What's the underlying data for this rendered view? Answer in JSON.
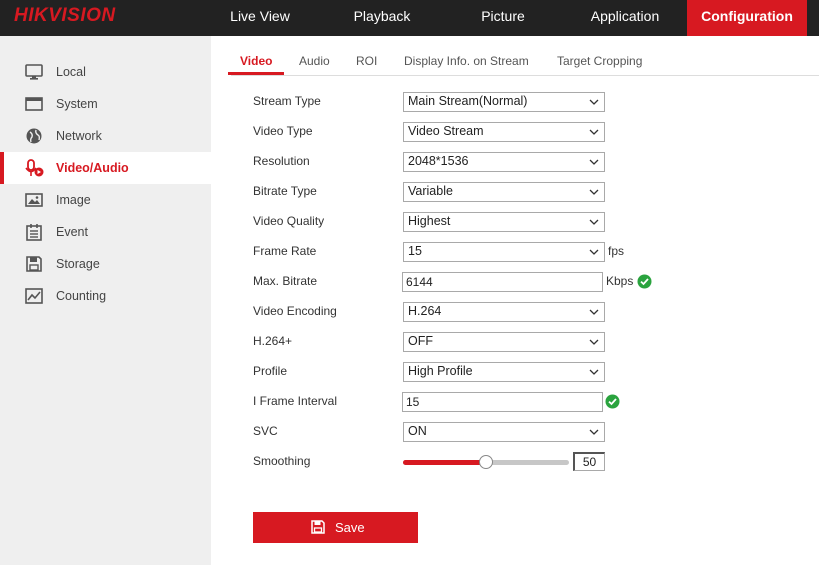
{
  "brand": {
    "logo": "HIKVISION",
    "accent": "#d71921"
  },
  "nav": {
    "items": [
      {
        "label": "Live View"
      },
      {
        "label": "Playback"
      },
      {
        "label": "Picture"
      },
      {
        "label": "Application"
      },
      {
        "label": "Configuration",
        "active": true
      }
    ]
  },
  "sidebar": {
    "items": [
      {
        "label": "Local",
        "icon": "monitor-icon"
      },
      {
        "label": "System",
        "icon": "system-icon"
      },
      {
        "label": "Network",
        "icon": "globe-icon"
      },
      {
        "label": "Video/Audio",
        "icon": "microphone-icon",
        "active": true
      },
      {
        "label": "Image",
        "icon": "image-icon"
      },
      {
        "label": "Event",
        "icon": "event-icon"
      },
      {
        "label": "Storage",
        "icon": "storage-icon"
      },
      {
        "label": "Counting",
        "icon": "chart-icon"
      }
    ]
  },
  "tabs": [
    {
      "label": "Video",
      "active": true
    },
    {
      "label": "Audio"
    },
    {
      "label": "ROI"
    },
    {
      "label": "Display Info. on Stream"
    },
    {
      "label": "Target Cropping"
    }
  ],
  "form": {
    "stream_type": {
      "label": "Stream Type",
      "value": "Main Stream(Normal)"
    },
    "video_type": {
      "label": "Video Type",
      "value": "Video Stream"
    },
    "resolution": {
      "label": "Resolution",
      "value": "2048*1536"
    },
    "bitrate_type": {
      "label": "Bitrate Type",
      "value": "Variable"
    },
    "video_quality": {
      "label": "Video Quality",
      "value": "Highest"
    },
    "frame_rate": {
      "label": "Frame Rate",
      "value": "15",
      "unit": "fps"
    },
    "max_bitrate": {
      "label": "Max. Bitrate",
      "value": "6144",
      "unit": "Kbps"
    },
    "video_encoding": {
      "label": "Video Encoding",
      "value": "H.264"
    },
    "h264plus": {
      "label": "H.264+",
      "value": "OFF"
    },
    "profile": {
      "label": "Profile",
      "value": "High Profile"
    },
    "i_frame_interval": {
      "label": "I Frame Interval",
      "value": "15"
    },
    "svc": {
      "label": "SVC",
      "value": "ON"
    },
    "smoothing": {
      "label": "Smoothing",
      "value": "50",
      "fraction": 0.5
    }
  },
  "save_label": "Save"
}
